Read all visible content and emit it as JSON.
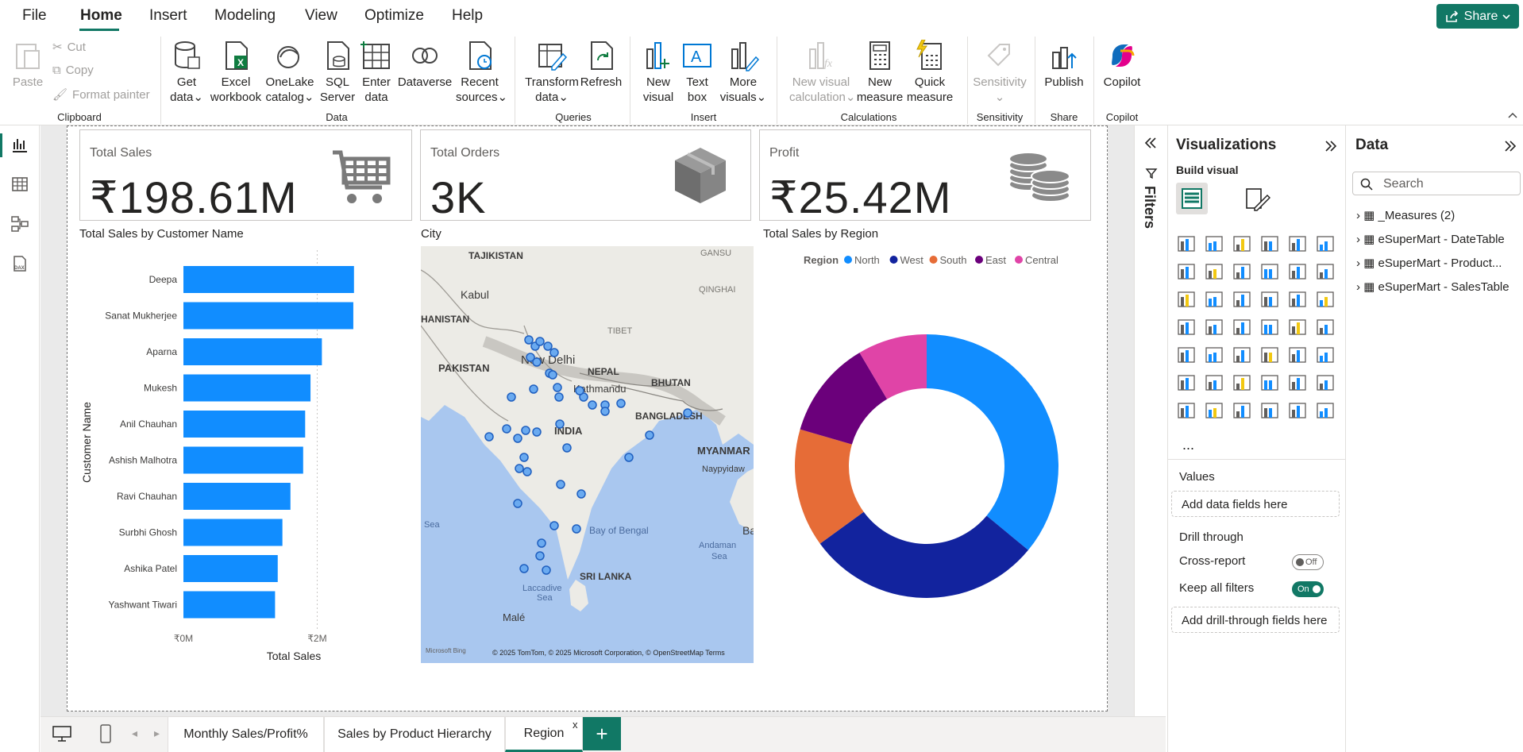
{
  "menu": [
    "File",
    "Home",
    "Insert",
    "Modeling",
    "View",
    "Optimize",
    "Help"
  ],
  "share_label": "Share",
  "ribbon": {
    "clipboard": {
      "paste": "Paste",
      "cut": "Cut",
      "copy": "Copy",
      "format_painter": "Format painter",
      "group": "Clipboard"
    },
    "data": {
      "get_data": [
        "Get",
        "data"
      ],
      "excel": [
        "Excel",
        "workbook"
      ],
      "onelake": [
        "OneLake",
        "catalog"
      ],
      "sql": [
        "SQL",
        "Server"
      ],
      "enter": [
        "Enter",
        "data"
      ],
      "dataverse": "Dataverse",
      "recent": [
        "Recent",
        "sources"
      ],
      "group": "Data"
    },
    "queries": {
      "transform": [
        "Transform",
        "data"
      ],
      "refresh": "Refresh",
      "group": "Queries"
    },
    "insert": {
      "new_visual": [
        "New",
        "visual"
      ],
      "text_box": [
        "Text",
        "box"
      ],
      "more_visuals": [
        "More",
        "visuals"
      ],
      "group": "Insert"
    },
    "calculations": {
      "new_visual_calc": [
        "New visual",
        "calculation"
      ],
      "new_measure": [
        "New",
        "measure"
      ],
      "quick_measure": [
        "Quick",
        "measure"
      ],
      "group": "Calculations"
    },
    "sensitivity": {
      "label": "Sensitivity",
      "group": "Sensitivity"
    },
    "share": {
      "publish": "Publish",
      "group": "Share"
    },
    "copilot": {
      "label": "Copilot",
      "group": "Copilot"
    }
  },
  "cards": [
    {
      "title": "Total Sales",
      "value": "₹198.61M",
      "icon": "cart-icon"
    },
    {
      "title": "Total Orders",
      "value": "3K",
      "icon": "box-icon"
    },
    {
      "title": "Profit",
      "value": "₹25.42M",
      "icon": "coins-icon"
    }
  ],
  "bar_title": "Total Sales by Customer Name",
  "map_title": "City",
  "donut_title": "Total Sales by Region",
  "map": {
    "labels": [
      "TAJIKISTAN",
      "Kabul",
      "HANISTAN",
      "PAKISTAN",
      "New Delhi",
      "NEPAL",
      "BHUTAN",
      "Kathmandu",
      "TIBET",
      "QINGHAI",
      "GANSU",
      "BANGLADESH",
      "INDIA",
      "MYANMAR",
      "Naypyidaw",
      "Bay of Bengal",
      "Andaman",
      "Sea",
      "Ba",
      "SRI LANKA",
      "Laccadive",
      "Sea",
      "Malé",
      "Sea"
    ],
    "credit": "© 2025 TomTom, © 2025 Microsoft Corporation, © OpenStreetMap  Terms",
    "bing": "Microsoft Bing",
    "openstreetmap": "© OpenStreetMap",
    "terms": "Terms"
  },
  "chart_data": [
    {
      "type": "bar",
      "title": "Total Sales by Customer Name",
      "xlabel": "Total Sales",
      "ylabel": "Customer Name",
      "categories": [
        "Deepa",
        "Sanat Mukherjee",
        "Aparna",
        "Mukesh",
        "Anil Chauhan",
        "Ashish Malhotra",
        "Ravi Chauhan",
        "Surbhi Ghosh",
        "Ashika Patel",
        "Yashwant Tiwari"
      ],
      "values": [
        2.55,
        2.54,
        2.07,
        1.9,
        1.82,
        1.79,
        1.6,
        1.48,
        1.41,
        1.37
      ],
      "xlim": [
        0,
        2.6
      ],
      "ticks": [
        "₹0M",
        "₹2M"
      ],
      "tick_values": [
        0,
        2
      ],
      "color": "#118dff"
    },
    {
      "type": "pie",
      "title": "Total Sales by Region",
      "legend_title": "Region",
      "categories": [
        "North",
        "West",
        "South",
        "East",
        "Central"
      ],
      "values": [
        36,
        29,
        14.5,
        12,
        8.5
      ],
      "colors": [
        "#118dff",
        "#12239e",
        "#e66c37",
        "#6b007b",
        "#e044a7"
      ],
      "legend": "top"
    }
  ],
  "filters_label": "Filters",
  "viz": {
    "title": "Visualizations",
    "build_visual": "Build visual",
    "values": "Values",
    "add_data": "Add data fields here",
    "drill": "Drill through",
    "cross_report": "Cross-report",
    "keep_filters": "Keep all filters",
    "off": "Off",
    "on": "On",
    "add_drill": "Add drill-through fields here",
    "more": "..."
  },
  "data_pane": {
    "title": "Data",
    "search_placeholder": "Search",
    "tables": [
      "_Measures (2)",
      "eSuperMart - DateTable",
      "eSuperMart - Product...",
      "eSuperMart - SalesTable"
    ]
  },
  "tabs": [
    "Monthly Sales/Profit%",
    "Sales by Product Hierarchy",
    "Region"
  ],
  "tab_close": "x",
  "add_page": "+"
}
